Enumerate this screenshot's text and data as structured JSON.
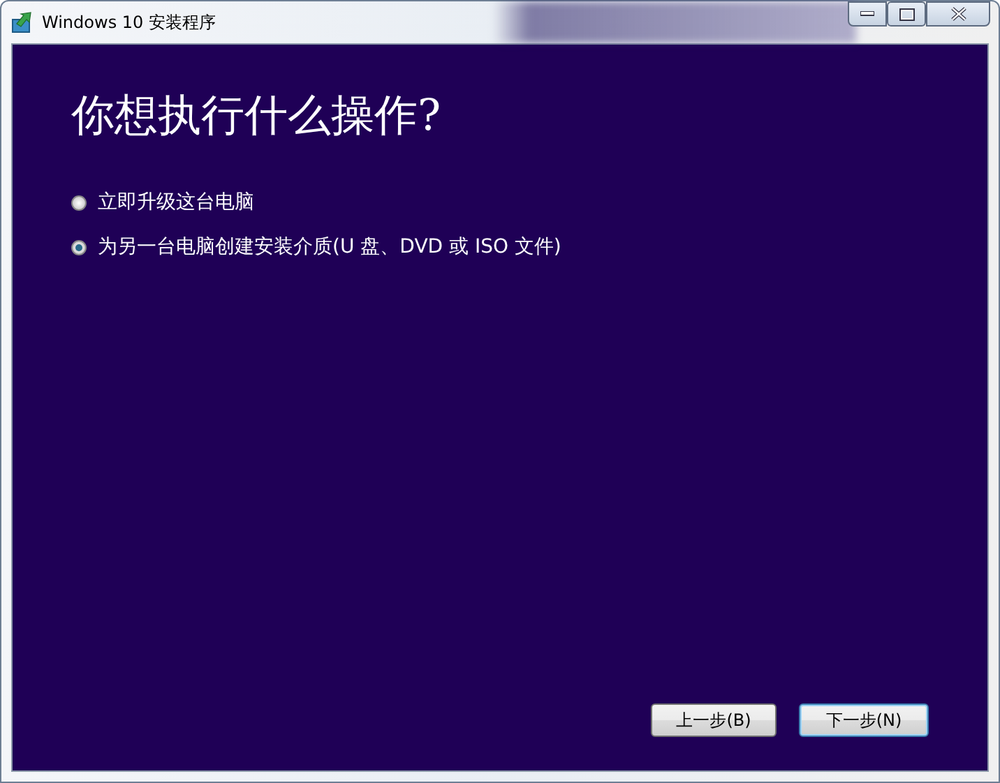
{
  "window": {
    "title": "Windows 10 安装程序"
  },
  "heading": "你想执行什么操作?",
  "options": [
    {
      "label": "立即升级这台电脑",
      "selected": false
    },
    {
      "label": "为另一台电脑创建安装介质(U 盘、DVD 或 ISO 文件)",
      "selected": true
    }
  ],
  "buttons": [
    {
      "label": "上一步(B)",
      "default": false
    },
    {
      "label": "下一步(N)",
      "default": true
    }
  ]
}
